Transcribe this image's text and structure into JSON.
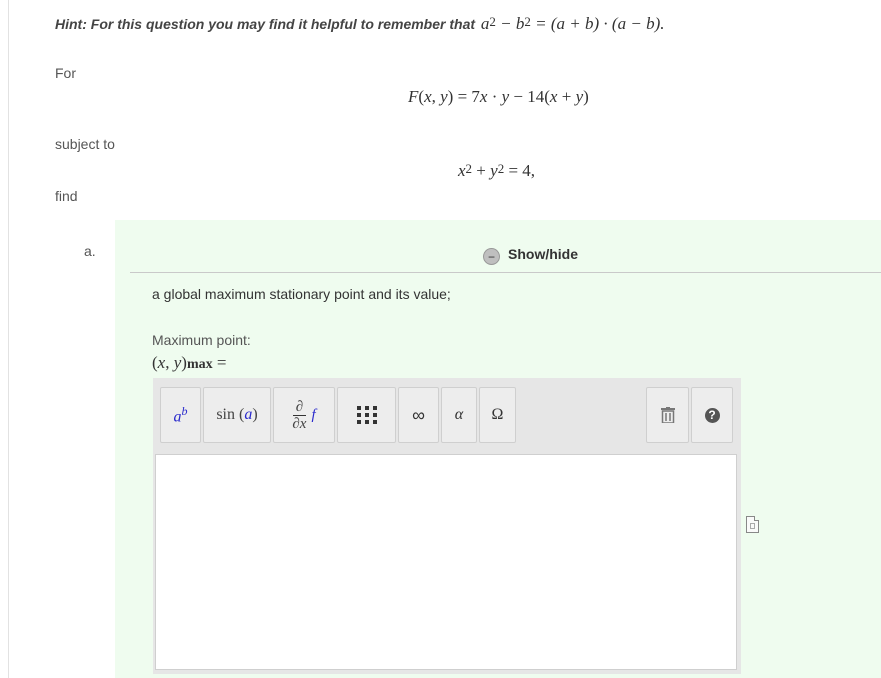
{
  "hint": {
    "text": "Hint: For this question you may find it helpful to remember that",
    "end": "."
  },
  "labels": {
    "for": "For",
    "subject_to": "subject to",
    "find": "find"
  },
  "part": {
    "letter": "a.",
    "show_hide_label": "Show/hide",
    "show_hide_icon": "minus-icon",
    "question": "a global maximum stationary point and its value;",
    "answer_label": "Maximum point:",
    "answer_sub": "max",
    "answer_eq": "="
  },
  "toolbar": {
    "sin_text": "sin",
    "sin_arg": "a",
    "deriv_num": "∂",
    "deriv_den": "∂x",
    "deriv_f": "f",
    "infinity": "∞",
    "alpha": "α",
    "omega": "Ω",
    "help": "?",
    "icons": [
      "power-icon",
      "trig-icon",
      "derivative-icon",
      "matrix-icon",
      "infinity-icon",
      "greek-icon",
      "symbol-icon",
      "trash-icon",
      "help-icon"
    ]
  },
  "editor": {
    "value": ""
  },
  "side_icon": "document-icon",
  "colors": {
    "panel_bg": "#effcef",
    "toolbar_bg": "#e6e6e6",
    "accent_blue": "#2a2acc"
  }
}
